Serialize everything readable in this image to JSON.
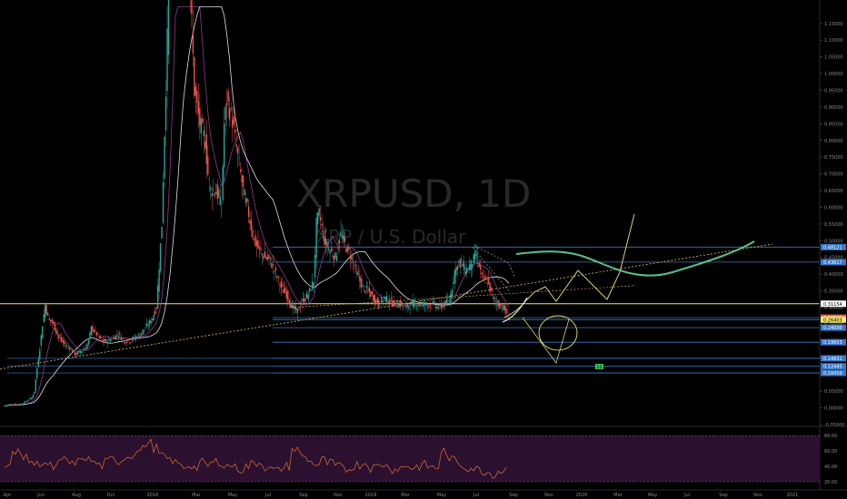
{
  "watermark": {
    "symbol": "XRPUSD, 1D",
    "description": "XRP / U.S. Dollar"
  },
  "colors": {
    "background": "#000000",
    "up_candle": "#26a69a",
    "down_candle": "#ef5350",
    "ma_white": "#e0e0e0",
    "ma_purple": "#8e3a8e",
    "support_yellow": "#f5e663",
    "level_blue": "#3a78c8",
    "projection_green": "#57c28a",
    "projection_yellow": "#d8d36a",
    "trend_dotted": "#c9a94d",
    "rsi_line": "#e0722a",
    "rsi_band": "#2b1030"
  },
  "chart_data": {
    "type": "candlestick",
    "symbol": "XRPUSD",
    "interval": "1D",
    "ylim": [
      -0.05,
      1.22
    ],
    "y_ticks": [
      "1.15000",
      "1.10000",
      "1.05000",
      "1.00000",
      "0.95000",
      "0.90000",
      "0.85000",
      "0.80000",
      "0.75000",
      "0.70000",
      "0.65000",
      "0.60000",
      "0.55000",
      "0.50000",
      "0.45000",
      "0.40000",
      "0.35000",
      "0.30000",
      "0.25000",
      "0.20000",
      "0.15000",
      "0.10000",
      "0.05000",
      "0.00000",
      "-0.05000"
    ],
    "x_tick_labels": [
      "Apr",
      "Jun",
      "Aug",
      "Oct",
      "2018",
      "Mar",
      "May",
      "Jul",
      "Sep",
      "Nov",
      "2019",
      "Mar",
      "May",
      "Jul",
      "Sep",
      "Nov",
      "2020",
      "Mar",
      "May",
      "Jul",
      "Sep",
      "Nov",
      "2021"
    ],
    "price_path": [
      [
        0,
        0.006
      ],
      [
        2,
        0.01
      ],
      [
        4,
        0.01
      ],
      [
        6,
        0.011
      ],
      [
        8,
        0.02
      ],
      [
        10,
        0.03
      ],
      [
        11,
        0.05
      ],
      [
        12,
        0.12
      ],
      [
        13,
        0.18
      ],
      [
        14,
        0.25
      ],
      [
        15,
        0.31
      ],
      [
        16,
        0.27
      ],
      [
        18,
        0.25
      ],
      [
        20,
        0.21
      ],
      [
        22,
        0.19
      ],
      [
        24,
        0.18
      ],
      [
        26,
        0.16
      ],
      [
        28,
        0.17
      ],
      [
        30,
        0.18
      ],
      [
        31,
        0.2
      ],
      [
        32,
        0.24
      ],
      [
        34,
        0.22
      ],
      [
        36,
        0.2
      ],
      [
        38,
        0.2
      ],
      [
        40,
        0.21
      ],
      [
        42,
        0.22
      ],
      [
        44,
        0.2
      ],
      [
        46,
        0.2
      ],
      [
        48,
        0.21
      ],
      [
        50,
        0.22
      ],
      [
        52,
        0.24
      ],
      [
        54,
        0.26
      ],
      [
        56,
        0.3
      ],
      [
        58,
        0.55
      ],
      [
        60,
        1.1
      ],
      [
        62,
        1.8
      ],
      [
        64,
        2.3
      ],
      [
        65,
        2.6
      ],
      [
        66,
        2.2
      ],
      [
        67,
        1.6
      ],
      [
        68,
        1.35
      ],
      [
        69,
        1.15
      ],
      [
        70,
        0.95
      ],
      [
        72,
        0.85
      ],
      [
        74,
        0.8
      ],
      [
        75,
        0.7
      ],
      [
        76,
        0.65
      ],
      [
        78,
        0.65
      ],
      [
        80,
        0.6
      ],
      [
        81,
        0.85
      ],
      [
        82,
        0.92
      ],
      [
        84,
        0.86
      ],
      [
        86,
        0.75
      ],
      [
        88,
        0.65
      ],
      [
        90,
        0.58
      ],
      [
        92,
        0.5
      ],
      [
        94,
        0.47
      ],
      [
        96,
        0.45
      ],
      [
        98,
        0.44
      ],
      [
        100,
        0.4
      ],
      [
        102,
        0.36
      ],
      [
        104,
        0.34
      ],
      [
        106,
        0.3
      ],
      [
        108,
        0.29
      ],
      [
        110,
        0.32
      ],
      [
        112,
        0.34
      ],
      [
        114,
        0.38
      ],
      [
        115,
        0.55
      ],
      [
        116,
        0.58
      ],
      [
        118,
        0.5
      ],
      [
        120,
        0.47
      ],
      [
        122,
        0.45
      ],
      [
        124,
        0.52
      ],
      [
        126,
        0.48
      ],
      [
        128,
        0.45
      ],
      [
        130,
        0.4
      ],
      [
        132,
        0.36
      ],
      [
        134,
        0.35
      ],
      [
        136,
        0.33
      ],
      [
        138,
        0.31
      ],
      [
        140,
        0.33
      ],
      [
        142,
        0.32
      ],
      [
        144,
        0.31
      ],
      [
        146,
        0.31
      ],
      [
        148,
        0.3
      ],
      [
        150,
        0.31
      ],
      [
        152,
        0.31
      ],
      [
        154,
        0.31
      ],
      [
        156,
        0.31
      ],
      [
        158,
        0.31
      ],
      [
        160,
        0.3
      ],
      [
        162,
        0.31
      ],
      [
        164,
        0.32
      ],
      [
        165,
        0.36
      ],
      [
        166,
        0.41
      ],
      [
        168,
        0.44
      ],
      [
        170,
        0.41
      ],
      [
        172,
        0.43
      ],
      [
        174,
        0.46
      ],
      [
        176,
        0.39
      ],
      [
        178,
        0.38
      ],
      [
        180,
        0.33
      ],
      [
        182,
        0.31
      ],
      [
        184,
        0.3
      ],
      [
        186,
        0.27
      ]
    ],
    "support_level": 0.3115,
    "price_levels": [
      {
        "value": "0.48121",
        "y": 0.481
      },
      {
        "value": "0.43617",
        "y": 0.436
      },
      {
        "value": "0.31154",
        "y": 0.3115
      },
      {
        "value": "0.26990",
        "y": 0.2699
      },
      {
        "value": "0.26403",
        "y": 0.264
      },
      {
        "value": "0.24000",
        "y": 0.24
      },
      {
        "value": "0.19653",
        "y": 0.1965
      },
      {
        "value": "0.14831",
        "y": 0.1483
      },
      {
        "value": "0.12445",
        "y": 0.1244
      },
      {
        "value": "0.10450",
        "y": 0.1045
      }
    ],
    "rsi": {
      "levels": [
        "80.00",
        "60.00",
        "40.00",
        "20.00"
      ],
      "values": [
        40,
        55,
        62,
        50,
        48,
        42,
        45,
        40,
        38,
        44,
        50,
        42,
        46,
        52,
        48,
        44,
        41,
        45,
        49,
        47,
        52,
        55,
        58,
        62,
        70,
        64,
        55,
        50,
        48,
        44,
        40,
        42,
        38,
        45,
        41,
        44,
        46,
        40,
        42,
        38,
        36,
        40,
        43,
        45,
        39,
        36,
        34,
        38,
        40,
        62,
        55,
        50,
        45,
        42,
        48,
        44,
        40,
        38,
        36,
        40,
        42,
        44,
        38,
        40,
        43,
        40,
        36,
        38,
        41,
        38,
        40,
        42,
        40,
        38,
        60,
        52,
        48,
        44,
        40,
        38,
        36,
        34,
        32,
        30,
        34,
        36
      ]
    }
  },
  "annotations": {
    "badge_label": "11"
  }
}
